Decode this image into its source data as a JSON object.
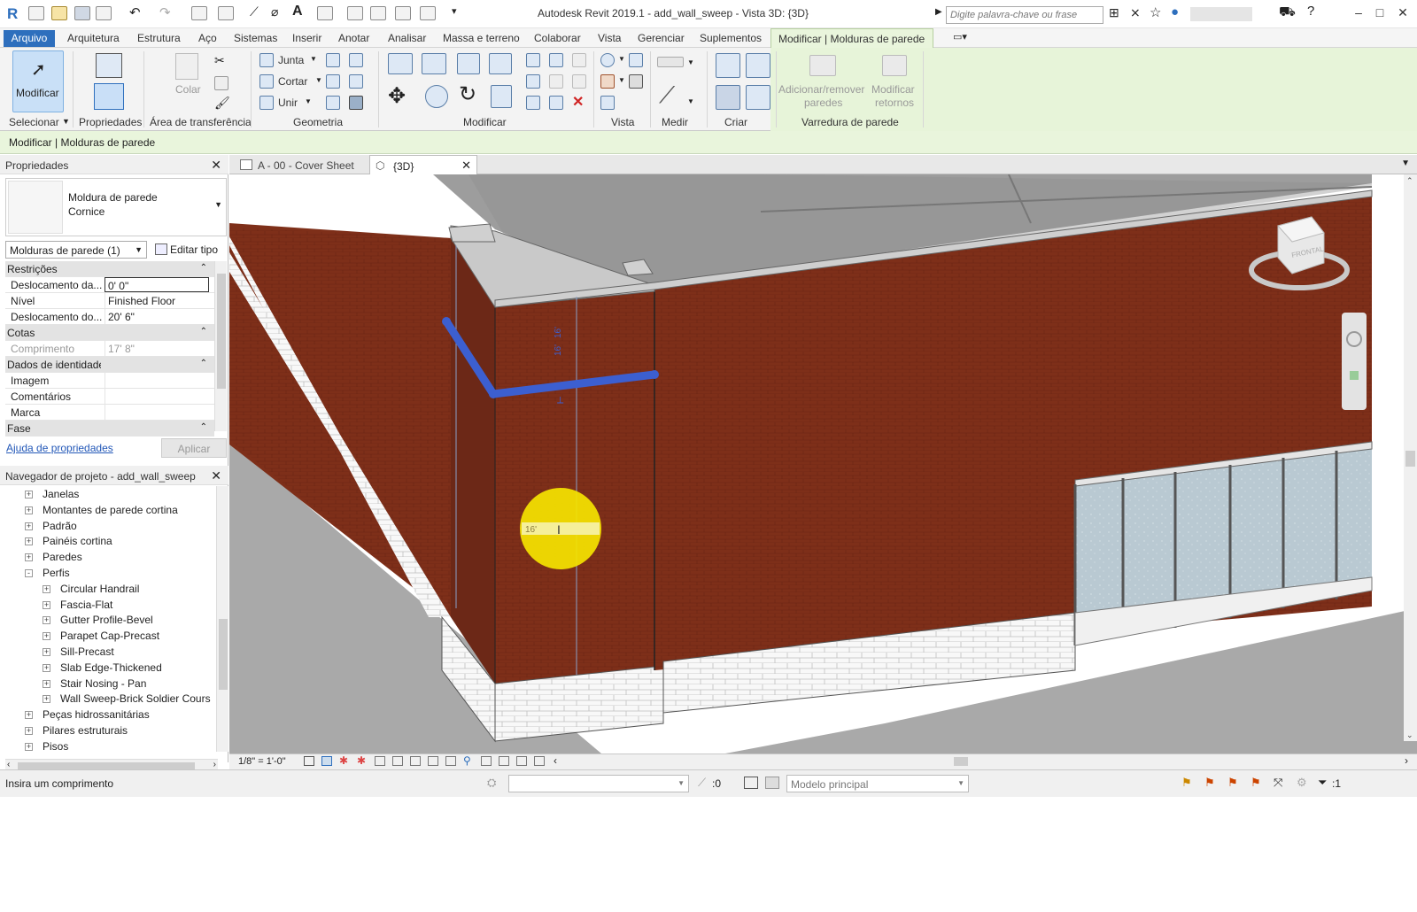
{
  "window": {
    "title": "Autodesk Revit 2019.1 - add_wall_sweep - Vista 3D: {3D}",
    "search_placeholder": "Digite palavra-chave ou frase"
  },
  "menu_tabs": [
    "Arquivo",
    "Arquitetura",
    "Estrutura",
    "Aço",
    "Sistemas",
    "Inserir",
    "Anotar",
    "Analisar",
    "Massa e terreno",
    "Colaborar",
    "Vista",
    "Gerenciar",
    "Suplementos",
    "Modificar | Molduras de parede"
  ],
  "ribbon": {
    "modificar_label": "Modificar",
    "propriedades_label": "Propriedades",
    "colar_label": "Colar",
    "junta_label": "Junta",
    "cortar_label": "Cortar",
    "unir_label": "Unir",
    "adicionar_label_1": "Adicionar/remover",
    "adicionar_label_2": "paredes",
    "modificar_retornos_1": "Modificar",
    "modificar_retornos_2": "retornos",
    "panels": {
      "selecionar": "Selecionar",
      "propriedades": "Propriedades",
      "area": "Área de transferência",
      "geometria": "Geometria",
      "modificar": "Modificar",
      "vista": "Vista",
      "medir": "Medir",
      "criar": "Criar",
      "varredura": "Varredura de parede"
    }
  },
  "context_line": "Modificar | Molduras de parede",
  "properties": {
    "title": "Propriedades",
    "type_name": "Moldura de parede",
    "type_sub": "Cornice",
    "instance_filter": "Molduras de parede (1)",
    "edit_type": "Editar tipo",
    "groups": {
      "restricoes": "Restrições",
      "cotas": "Cotas",
      "identidade": "Dados de identidade",
      "fase": "Fase"
    },
    "rows": {
      "desloc_base_label": "Deslocamento da...",
      "desloc_base_value": "0'  0\"",
      "nivel_label": "Nível",
      "nivel_value": "Finished Floor",
      "desloc_nivel_label": "Deslocamento do...",
      "desloc_nivel_value": "20'  6\"",
      "comprimento_label": "Comprimento",
      "comprimento_value": "17'  8\"",
      "imagem_label": "Imagem",
      "comentarios_label": "Comentários",
      "marca_label": "Marca"
    },
    "help_link": "Ajuda de propriedades",
    "apply_button": "Aplicar"
  },
  "browser": {
    "title": "Navegador de projeto - add_wall_sweep",
    "items": [
      {
        "label": "Janelas",
        "level": 1,
        "expander": "+"
      },
      {
        "label": "Montantes de parede cortina",
        "level": 1,
        "expander": "+"
      },
      {
        "label": "Padrão",
        "level": 1,
        "expander": "+"
      },
      {
        "label": "Painéis cortina",
        "level": 1,
        "expander": "+"
      },
      {
        "label": "Paredes",
        "level": 1,
        "expander": "+"
      },
      {
        "label": "Perfis",
        "level": 1,
        "expander": "-"
      },
      {
        "label": "Circular Handrail",
        "level": 2,
        "expander": "+"
      },
      {
        "label": "Fascia-Flat",
        "level": 2,
        "expander": "+"
      },
      {
        "label": "Gutter Profile-Bevel",
        "level": 2,
        "expander": "+"
      },
      {
        "label": "Parapet Cap-Precast",
        "level": 2,
        "expander": "+"
      },
      {
        "label": "Sill-Precast",
        "level": 2,
        "expander": "+"
      },
      {
        "label": "Slab Edge-Thickened",
        "level": 2,
        "expander": "+"
      },
      {
        "label": "Stair Nosing - Pan",
        "level": 2,
        "expander": "+"
      },
      {
        "label": "Wall Sweep-Brick Soldier Cours",
        "level": 2,
        "expander": "+"
      },
      {
        "label": "Peças hidrossanitárias",
        "level": 1,
        "expander": "+"
      },
      {
        "label": "Pilares estruturais",
        "level": 1,
        "expander": "+"
      },
      {
        "label": "Pisos",
        "level": 1,
        "expander": "+"
      }
    ]
  },
  "view_tabs": [
    {
      "label": "A - 00 - Cover Sheet",
      "icon": "sheet-icon"
    },
    {
      "label": "{3D}",
      "icon": "3d-view-icon"
    }
  ],
  "viewport": {
    "dimension_input": "16'",
    "viewcube_label": "FRONTAL"
  },
  "view_control": {
    "scale": "1/8\" = 1'-0\""
  },
  "status": {
    "prompt": "Insira um comprimento",
    "selection_count": ":0",
    "model": "Modelo principal",
    "filter_count": ":1"
  },
  "colors": {
    "accent": "#2e6fbd",
    "context_tab": "#e9f5dc",
    "brick": "#7b2f1a",
    "sweep": "#3c5fd0",
    "highlight": "#f5e400"
  }
}
